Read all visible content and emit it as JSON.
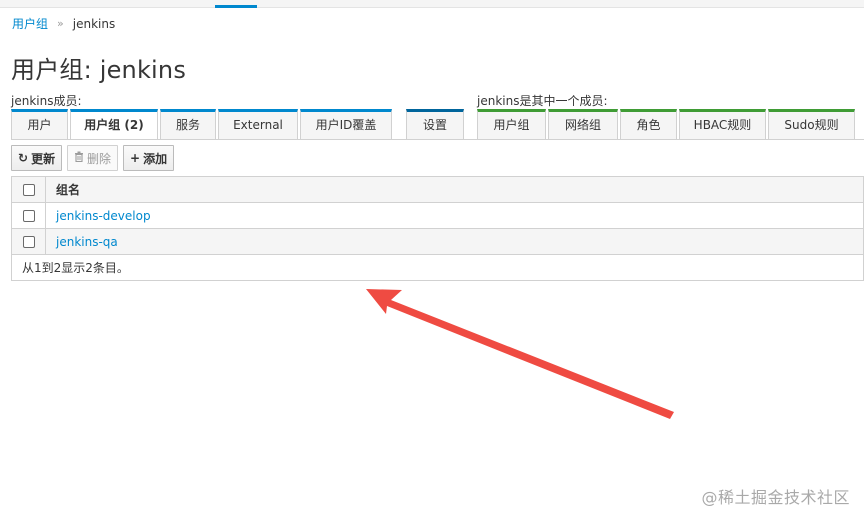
{
  "breadcrumb": {
    "parent": "用户组",
    "separator": "»",
    "current": "jenkins"
  },
  "page": {
    "title": "用户组: jenkins"
  },
  "members_section": {
    "label": "jenkins成员:",
    "tabs": [
      {
        "label": "用户",
        "active": false
      },
      {
        "label": "用户组 (2)",
        "active": true
      },
      {
        "label": "服务",
        "active": false
      },
      {
        "label": "External",
        "active": false
      },
      {
        "label": "用户ID覆盖",
        "active": false
      }
    ]
  },
  "settings_tab": {
    "label": "设置"
  },
  "member_of_section": {
    "label": "jenkins是其中一个成员:",
    "tabs": [
      {
        "label": "用户组"
      },
      {
        "label": "网络组"
      },
      {
        "label": "角色"
      },
      {
        "label": "HBAC规则"
      },
      {
        "label": "Sudo规则"
      }
    ]
  },
  "toolbar": {
    "refresh_icon": "refresh-icon",
    "refresh_label": "更新",
    "delete_icon": "trash-icon",
    "delete_label": "删除",
    "add_icon": "plus-icon",
    "add_label": "添加"
  },
  "table": {
    "header": "组名",
    "rows": [
      {
        "name": "jenkins-develop"
      },
      {
        "name": "jenkins-qa"
      }
    ],
    "footer": "从1到2显示2条目。"
  },
  "colors": {
    "link": "#0088ce",
    "tab_blue": "#0088ce",
    "tab_green": "#3f9c35",
    "annotation_arrow": "#ef4b42"
  },
  "watermark": "@稀土掘金技术社区"
}
